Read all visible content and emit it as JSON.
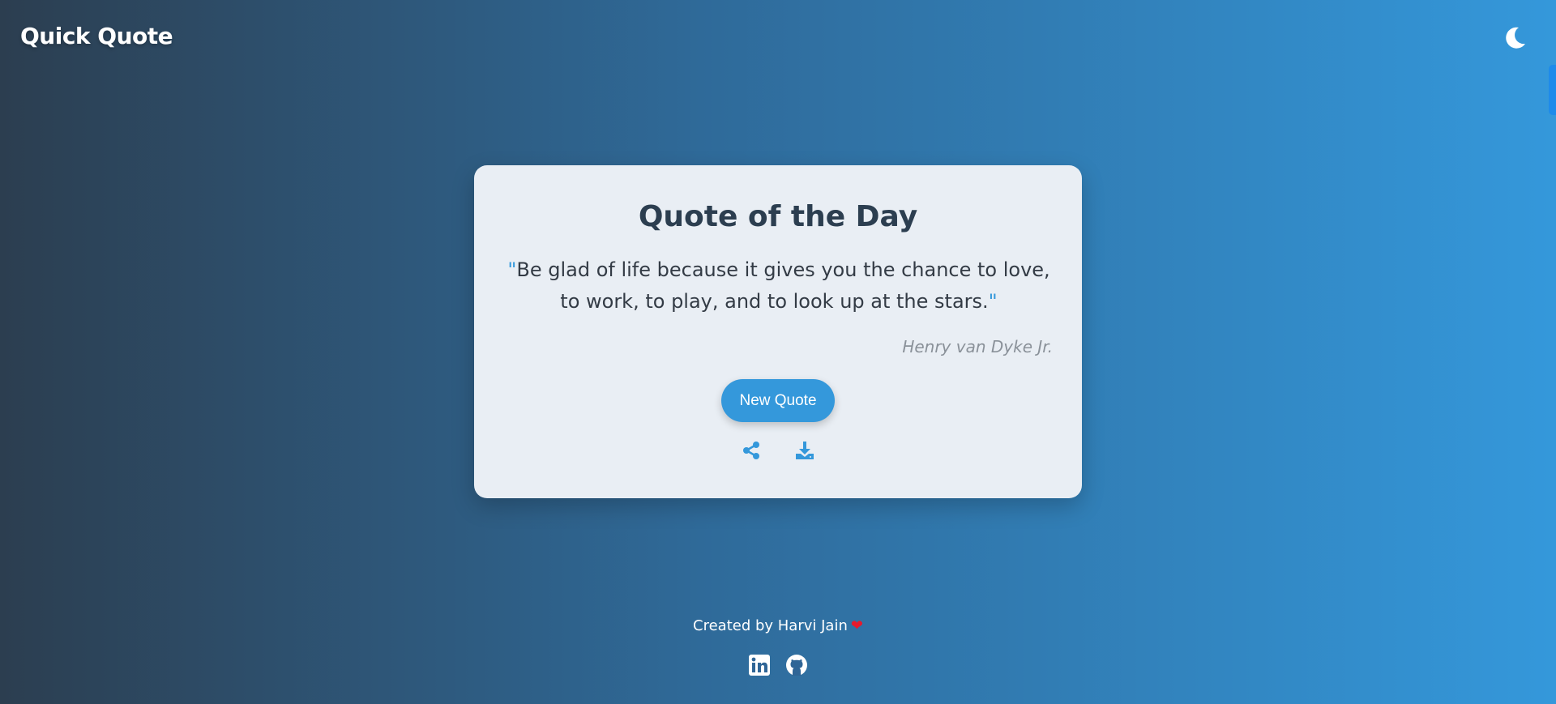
{
  "header": {
    "brand": "Quick Quote",
    "theme_icon": "moon-icon"
  },
  "card": {
    "title": "Quote of the Day",
    "quote_open": "\"",
    "quote": "Be glad of life because it gives you the chance to love, to work, to play, and to look up at the stars.",
    "quote_close": "\"",
    "author": "Henry van Dyke Jr.",
    "new_quote_label": "New Quote",
    "actions": [
      {
        "icon": "share-icon"
      },
      {
        "icon": "download-icon"
      }
    ]
  },
  "footer": {
    "credit": "Created by Harvi Jain",
    "heart": "❤",
    "social": [
      {
        "icon": "linkedin-icon"
      },
      {
        "icon": "github-icon"
      }
    ]
  },
  "colors": {
    "accent": "#3498db",
    "gradient_start": "#2c3e50",
    "gradient_end": "#3498db",
    "card_bg": "#e9eef4",
    "heart": "#e8192c"
  }
}
